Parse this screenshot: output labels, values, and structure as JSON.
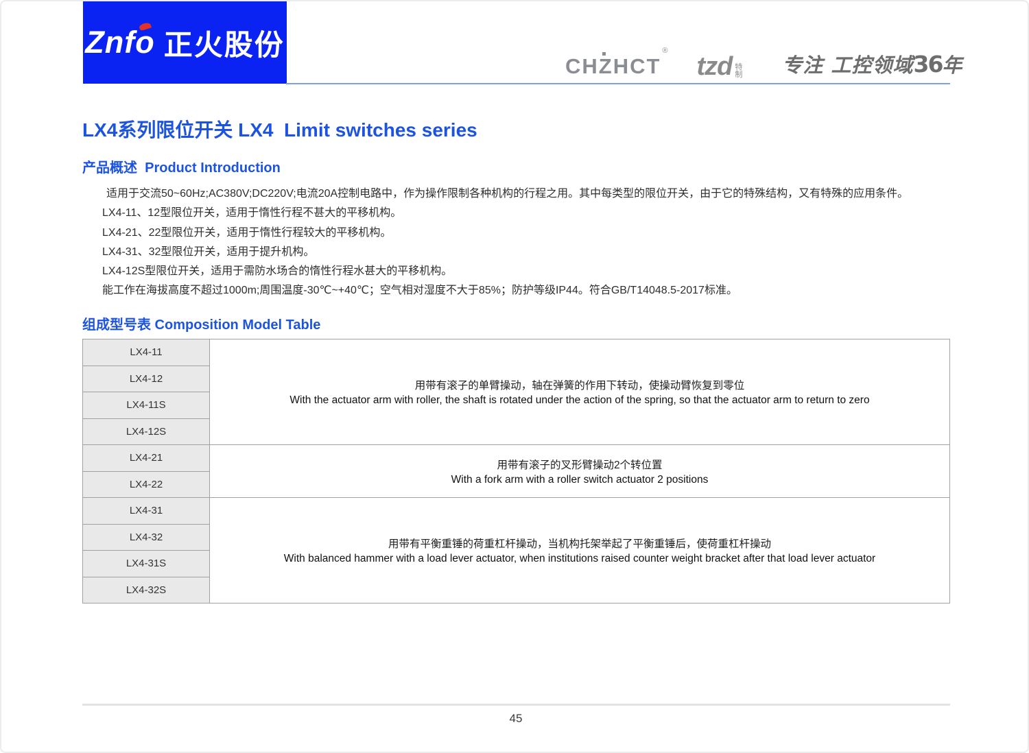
{
  "header": {
    "logo": {
      "brand_latin": "Znfo",
      "brand_cn": "正火股份"
    },
    "right": {
      "chzhct": "CHZHCT",
      "reg_mark": "®",
      "tzd": "tzd",
      "tzd_special_top": "特",
      "tzd_special_bottom": "制",
      "slogan_prefix": "专注 工控领域",
      "slogan_years": "36",
      "slogan_suffix": "年"
    }
  },
  "title": "LX4系列限位开关 LX4  Limit switches series",
  "sections": {
    "intro": {
      "heading": "产品概述  Product Introduction",
      "paragraphs": [
        "适用于交流50~60Hz;AC380V;DC220V;电流20A控制电路中，作为操作限制各种机构的行程之用。其中每类型的限位开关，由于它的特殊结构，又有特殊的应用条件。",
        "LX4-11、12型限位开关，适用于惰性行程不甚大的平移机构。",
        "LX4-21、22型限位开关，适用于惰性行程较大的平移机构。",
        "LX4-31、32型限位开关，适用于提升机构。",
        "LX4-12S型限位开关，适用于需防水场合的惰性行程水甚大的平移机构。",
        "能工作在海拔高度不超过1000m;周围温度-30℃~+40℃；空气相对湿度不大于85%；防护等级IP44。符合GB/T14048.5-2017标准。"
      ]
    },
    "model_table": {
      "heading": "组成型号表 Composition Model Table",
      "groups": [
        {
          "models": [
            "LX4-11",
            "LX4-12",
            "LX4-11S",
            "LX4-12S"
          ],
          "desc_cn": "用带有滚子的单臂操动，轴在弹簧的作用下转动，使操动臂恢复到零位",
          "desc_en": "With the actuator arm with roller, the shaft is rotated under the action of the spring, so that the actuator arm to return to zero"
        },
        {
          "models": [
            "LX4-21",
            "LX4-22"
          ],
          "desc_cn": "用带有滚子的叉形臂操动2个转位置",
          "desc_en": "With a fork arm with a roller switch actuator 2 positions"
        },
        {
          "models": [
            "LX4-31",
            "LX4-32",
            "LX4-31S",
            "LX4-32S"
          ],
          "desc_cn": "用带有平衡重锤的荷重杠杆操动，当机构托架举起了平衡重锤后，使荷重杠杆操动",
          "desc_en": "With balanced hammer with a load lever actuator, when institutions raised counter weight bracket after that load lever actuator"
        }
      ]
    }
  },
  "footer": {
    "page_number": "45"
  },
  "colors": {
    "brand_blue": "#0b23f2",
    "accent_blue": "#1d54df",
    "header_line_blue": "#79a1f0",
    "logo_red": "#e03227",
    "gray_logo_text": "#8a8e93",
    "body_text": "#2e2e2e",
    "table_border": "#a0a0a0",
    "model_cell_bg": "#e9e9e9"
  }
}
